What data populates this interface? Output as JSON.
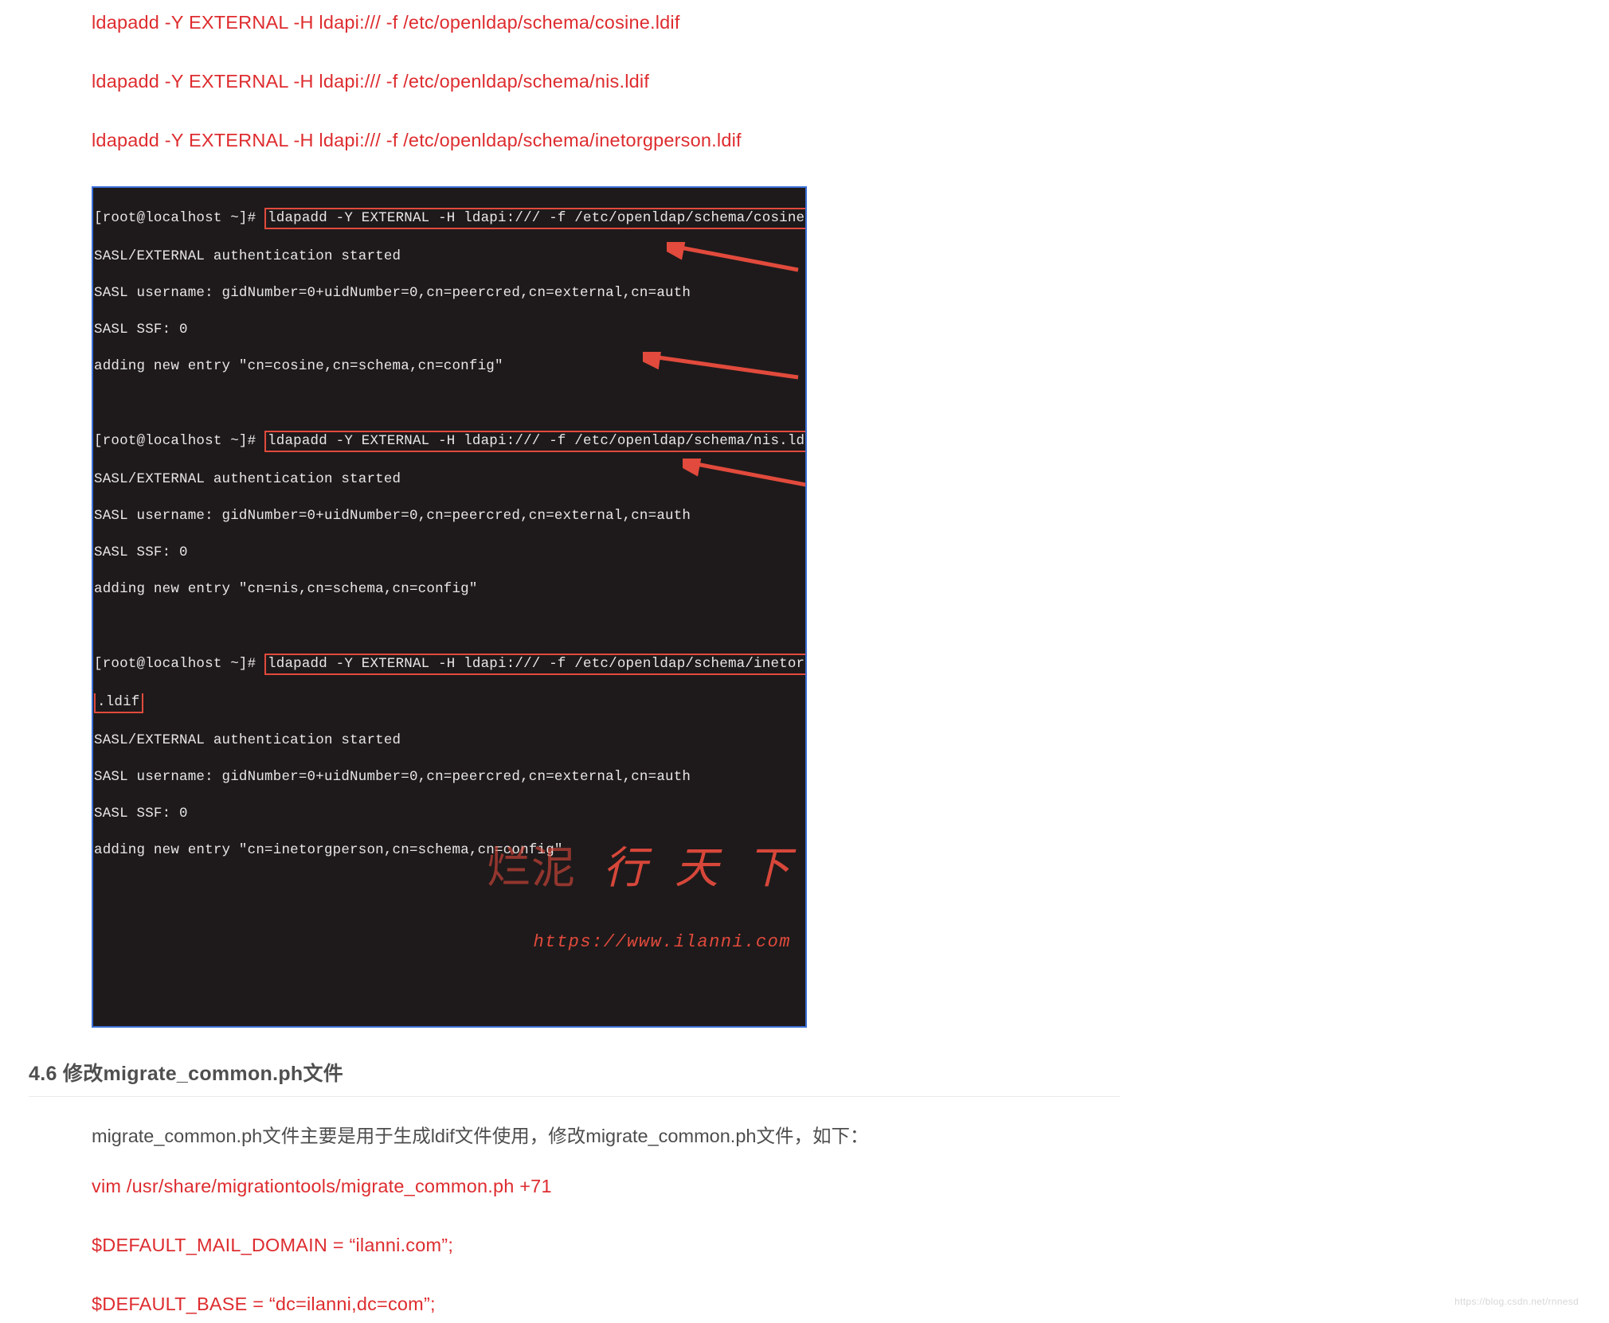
{
  "commands": [
    "ldapadd -Y EXTERNAL -H ldapi:/// -f /etc/openldap/schema/cosine.ldif",
    "ldapadd -Y EXTERNAL -H ldapi:/// -f /etc/openldap/schema/nis.ldif",
    "ldapadd -Y EXTERNAL -H ldapi:/// -f /etc/openldap/schema/inetorgperson.ldif"
  ],
  "terminal": {
    "blocks": [
      {
        "prompt": "[root@localhost ~]# ",
        "cmd": "ldapadd -Y EXTERNAL -H ldapi:/// -f /etc/openldap/schema/cosine.ldif",
        "lines": [
          "SASL/EXTERNAL authentication started",
          "SASL username: gidNumber=0+uidNumber=0,cn=peercred,cn=external,cn=auth",
          "SASL SSF: 0",
          "adding new entry \"cn=cosine,cn=schema,cn=config\""
        ]
      },
      {
        "prompt": "[root@localhost ~]# ",
        "cmd": "ldapadd -Y EXTERNAL -H ldapi:/// -f /etc/openldap/schema/nis.ldif",
        "lines": [
          "SASL/EXTERNAL authentication started",
          "SASL username: gidNumber=0+uidNumber=0,cn=peercred,cn=external,cn=auth",
          "SASL SSF: 0",
          "adding new entry \"cn=nis,cn=schema,cn=config\""
        ]
      },
      {
        "prompt": "[root@localhost ~]# ",
        "cmd": "ldapadd -Y EXTERNAL -H ldapi:/// -f /etc/openldap/schema/inetorgperson",
        "cmd_wrap2": ".ldif",
        "lines": [
          "SASL/EXTERNAL authentication started",
          "SASL username: gidNumber=0+uidNumber=0,cn=peercred,cn=external,cn=auth",
          "SASL SSF: 0",
          "adding new entry \"cn=inetorgperson,cn=schema,cn=config\""
        ]
      }
    ],
    "watermark_cn": "烂泥 行 天 下",
    "watermark_url": "https://www.ilanni.com"
  },
  "section": {
    "heading": "4.6 修改migrate_common.ph文件",
    "para": "migrate_common.ph文件主要是用于生成ldif文件使用，修改migrate_common.ph文件，如下：",
    "red_lines": [
      "vim /usr/share/migrationtools/migrate_common.ph +71",
      "$DEFAULT_MAIL_DOMAIN = “ilanni.com”;",
      "$DEFAULT_BASE = “dc=ilanni,dc=com”;"
    ]
  },
  "footer_watermark": "https://blog.csdn.net/rnnesd"
}
